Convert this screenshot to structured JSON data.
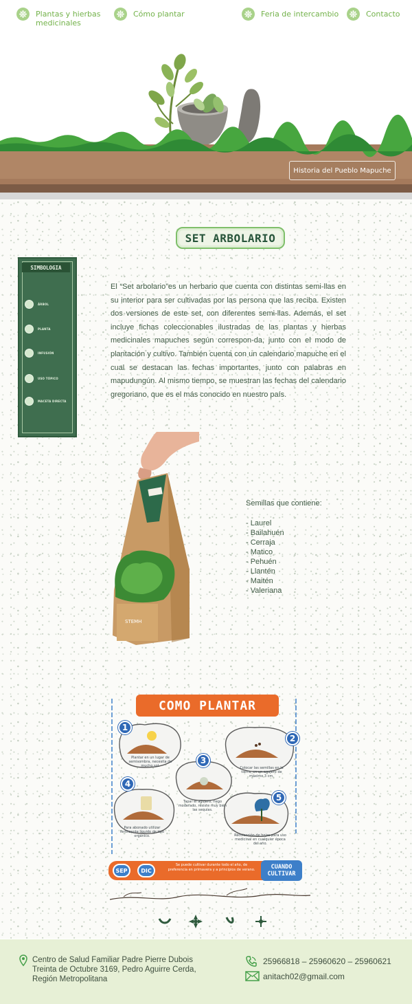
{
  "nav": {
    "items": [
      {
        "label": "Plantas y hierbas",
        "label2": "medicinales"
      },
      {
        "label": "Cómo plantar"
      },
      {
        "label": "Feria de intercambio"
      },
      {
        "label": "Contacto"
      }
    ]
  },
  "hero": {
    "history_button": "Historia del Pueblo Mapuche"
  },
  "section": {
    "title": "SET ARBOLARIO",
    "description": "El “Set arbolario”es un herbario que cuenta con distintas semi-llas en su interior para ser cultivadas por las persona que las reciba. Existen dos versiones de este set, con diferentes semi-llas. Además, el set incluye fichas coleccionables ilustradas de las plantas y hierbas medicinales mapuches según correspon-da, junto con el modo de plantación y cultivo. También cuenta con un calendario mapuche en el cual se destacan las fechas importantes, junto con palabras en mapudungún. Al mismo tiempo, se muestran las fechas del calendario gregoriano, que es el más conocido en nuestro país."
  },
  "simbologia": {
    "title": "SIMBOLOGIA",
    "items": [
      "ÁRBOL",
      "PLANTA",
      "INFUSIÓN",
      "USO TÓPICO",
      "MACETA DIRECTA"
    ]
  },
  "product": {
    "box_label": "STEMH"
  },
  "seeds": {
    "title": "Semillas que contiene:",
    "items": [
      "- Laurel",
      "- Bailahuén",
      "- Cerraja",
      "- Matico",
      "- Pehuén",
      "- Llantén",
      "- Maitén",
      "- Valeriana"
    ]
  },
  "how_to": {
    "title": "COMO PLANTAR",
    "steps": [
      {
        "num": "1",
        "text": "Plantar en un lugar de semisombra, necesita de mucho sol."
      },
      {
        "num": "2",
        "text": "Colocar las semillas en la tierra, en un agujero de máximo 3 cm."
      },
      {
        "num": "3",
        "text": "Tapar el agujero, riego moderado, resiste muy bien las sequías."
      },
      {
        "num": "4",
        "text": "Para abonado utilizar fertilizante líquido de tipo orgánico."
      },
      {
        "num": "5",
        "text": "Recolección de hojas para uso medicinal en cualquier época del año."
      }
    ],
    "month_from": "SEP",
    "month_to": "DIC",
    "banner_text": "Se puede cultivar durante todo el año, de preferencia en primavera y a principios de verano.",
    "cuando_1": "CUANDO",
    "cuando_2": "CULTIVAR"
  },
  "footer": {
    "address_1": "Centro de Salud Familiar Padre Pierre Dubois",
    "address_2": "Treinta de Octubre 3169, Pedro Aguirre Cerda,",
    "address_3": "Región Metropolitana",
    "phones": "25966818 – 25960620 – 25960621",
    "email": "anitach02@gmail.com"
  },
  "colors": {
    "nav_green": "#73b24a",
    "dark_green": "#3f6e4f",
    "orange": "#ea6b2a",
    "blue": "#2f68b6",
    "footer_bg": "#e7f0d6"
  }
}
